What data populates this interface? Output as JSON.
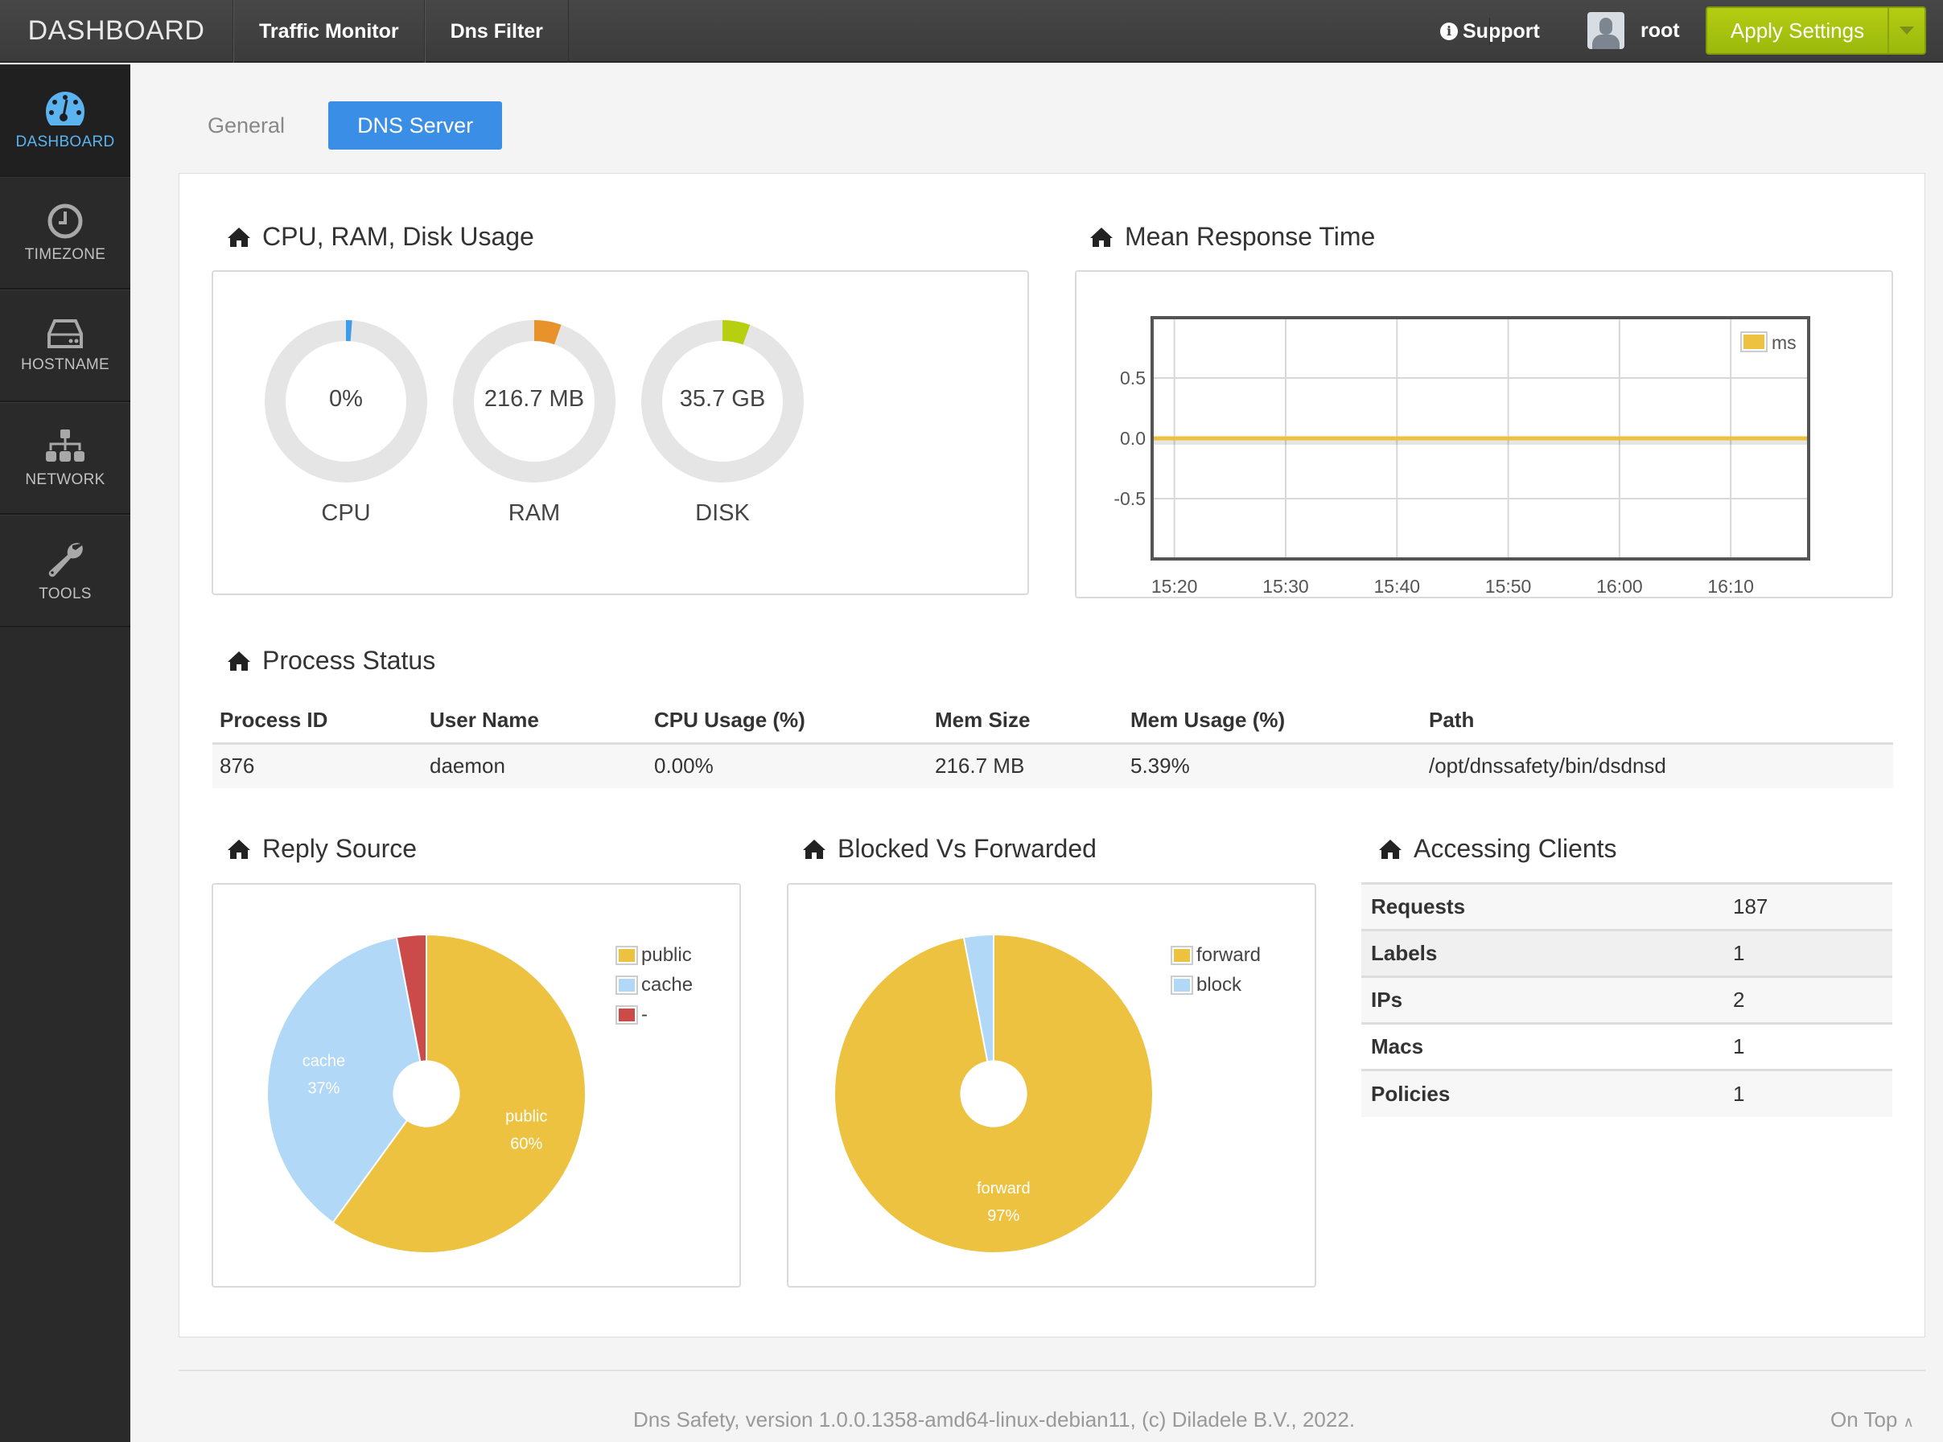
{
  "topbar": {
    "brand": "DASHBOARD",
    "nav": [
      "Traffic Monitor",
      "Dns Filter"
    ],
    "support_label": "Support",
    "user_name": "root",
    "apply_label": "Apply Settings"
  },
  "sidebar": {
    "items": [
      {
        "label": "DASHBOARD",
        "icon": "dashboard-gauge-icon",
        "active": true
      },
      {
        "label": "TIMEZONE",
        "icon": "clock-icon"
      },
      {
        "label": "HOSTNAME",
        "icon": "hard-drive-icon"
      },
      {
        "label": "NETWORK",
        "icon": "sitemap-icon"
      },
      {
        "label": "TOOLS",
        "icon": "wrench-icon"
      }
    ]
  },
  "tabs": [
    {
      "label": "General",
      "active": false
    },
    {
      "label": "DNS Server",
      "active": true
    }
  ],
  "usage": {
    "title": "CPU, RAM, Disk Usage",
    "gauges": [
      {
        "caption": "CPU",
        "value": "0%",
        "fraction": 0.0,
        "color": "#3d9be9"
      },
      {
        "caption": "RAM",
        "value": "216.7 MB",
        "fraction": 0.054,
        "color": "#e8922b"
      },
      {
        "caption": "DISK",
        "value": "35.7 GB",
        "fraction": 0.055,
        "color": "#b6cf0e"
      }
    ],
    "track_color": "#e5e5e5"
  },
  "response": {
    "title": "Mean Response Time"
  },
  "process": {
    "title": "Process Status",
    "headers": [
      "Process ID",
      "User Name",
      "CPU Usage (%)",
      "Mem Size",
      "Mem Usage (%)",
      "Path"
    ],
    "rows": [
      [
        "876",
        "daemon",
        "0.00%",
        "216.7 MB",
        "5.39%",
        "/opt/dnssafety/bin/dsdnsd"
      ]
    ]
  },
  "reply_source": {
    "title": "Reply Source"
  },
  "blocked": {
    "title": "Blocked Vs Forwarded"
  },
  "clients": {
    "title": "Accessing Clients",
    "rows": [
      {
        "key": "Requests",
        "value": "187"
      },
      {
        "key": "Labels",
        "value": "1"
      },
      {
        "key": "IPs",
        "value": "2"
      },
      {
        "key": "Macs",
        "value": "1"
      },
      {
        "key": "Policies",
        "value": "1"
      }
    ]
  },
  "footer": {
    "text": "Dns Safety, version 1.0.0.1358-amd64-linux-debian11, (c) Diladele B.V., 2022.",
    "on_top": "On Top"
  },
  "chart_data": [
    {
      "type": "line",
      "title": "Mean Response Time",
      "xlabel": "",
      "ylabel": "",
      "x_ticks": [
        "15:20",
        "15:30",
        "15:40",
        "15:50",
        "16:00",
        "16:10"
      ],
      "y_ticks": [
        "0.5",
        "0.0",
        "-0.5"
      ],
      "ylim": [
        -1.0,
        1.0
      ],
      "grid": true,
      "legend": "top-right",
      "series": [
        {
          "name": "ms",
          "color": "#ecc240",
          "x": [
            "15:18",
            "15:20",
            "15:30",
            "15:40",
            "15:50",
            "16:00",
            "16:10",
            "16:17"
          ],
          "values": [
            0,
            0,
            0,
            0,
            0,
            0,
            0,
            0
          ]
        }
      ]
    },
    {
      "type": "pie",
      "title": "Reply Source",
      "legend": "top-right",
      "donut_hole": true,
      "slices": [
        {
          "label": "public",
          "value": 60,
          "display": "60%",
          "color": "#ecc240"
        },
        {
          "label": "cache",
          "value": 37,
          "display": "37%",
          "color": "#b1d8f6"
        },
        {
          "label": "-",
          "value": 3,
          "display": "",
          "color": "#cb4b4b"
        }
      ]
    },
    {
      "type": "pie",
      "title": "Blocked Vs Forwarded",
      "legend": "top-right",
      "donut_hole": true,
      "slices": [
        {
          "label": "forward",
          "value": 97,
          "display": "97%",
          "color": "#ecc240"
        },
        {
          "label": "block",
          "value": 3,
          "display": "",
          "color": "#b1d8f6"
        }
      ]
    }
  ]
}
